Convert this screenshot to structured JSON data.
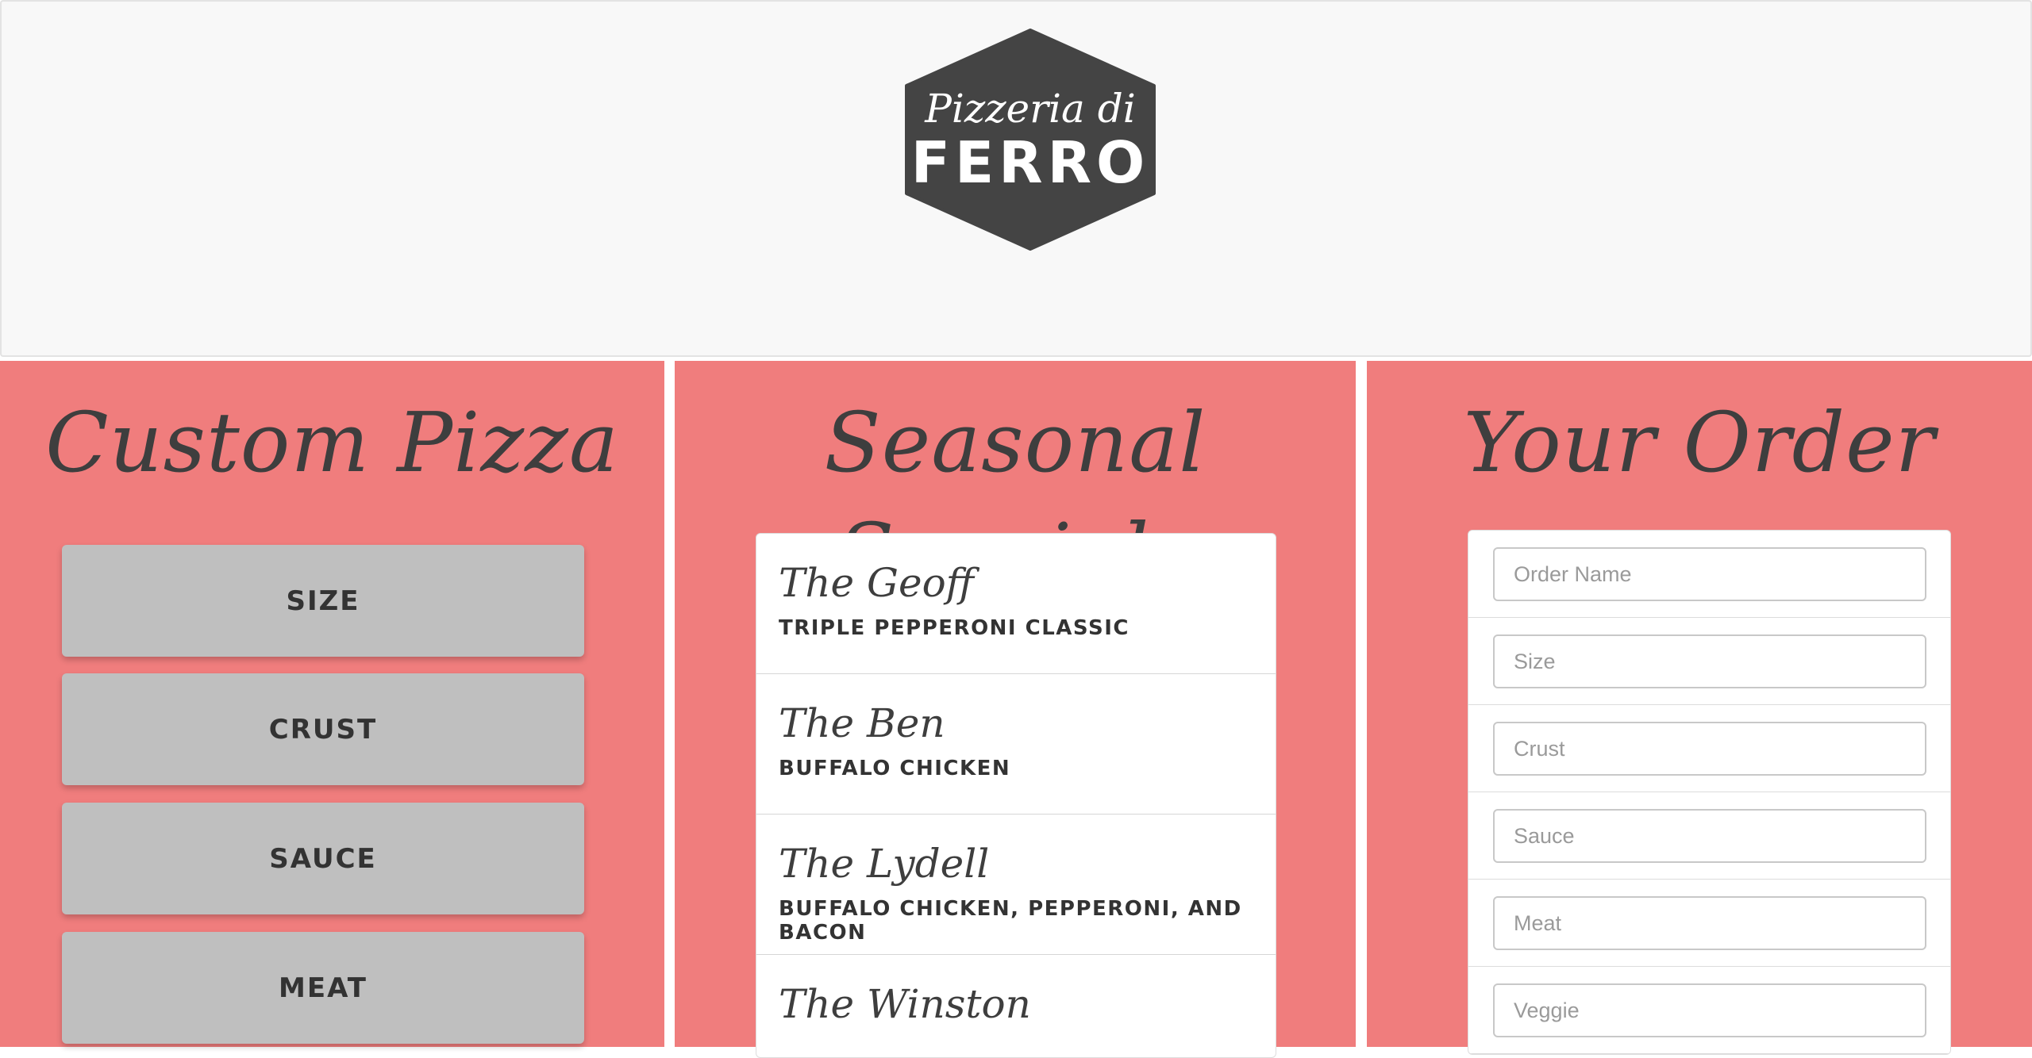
{
  "header": {
    "logo_top": "Pizzeria di",
    "logo_bottom": "FERRO"
  },
  "custom_pizza": {
    "title": "Custom Pizza",
    "options": [
      "SIZE",
      "CRUST",
      "SAUCE",
      "MEAT"
    ]
  },
  "seasonal_specials": {
    "title": "Seasonal Specials",
    "items": [
      {
        "name": "The Geoff",
        "description": "TRIPLE PEPPERONI CLASSIC"
      },
      {
        "name": "The Ben",
        "description": "BUFFALO CHICKEN"
      },
      {
        "name": "The Lydell",
        "description": "BUFFALO CHICKEN, PEPPERONI, AND BACON"
      },
      {
        "name": "The Winston",
        "description": ""
      }
    ]
  },
  "your_order": {
    "title": "Your Order",
    "fields": [
      {
        "placeholder": "Order Name",
        "value": ""
      },
      {
        "placeholder": "Size",
        "value": ""
      },
      {
        "placeholder": "Crust",
        "value": ""
      },
      {
        "placeholder": "Sauce",
        "value": ""
      },
      {
        "placeholder": "Meat",
        "value": ""
      },
      {
        "placeholder": "Veggie",
        "value": ""
      }
    ]
  },
  "colors": {
    "panel": "#f07d7d",
    "header_bg": "#f8f8f8",
    "logo": "#444444",
    "button": "#bfbfbf",
    "text_dark": "#3e3e3e"
  }
}
